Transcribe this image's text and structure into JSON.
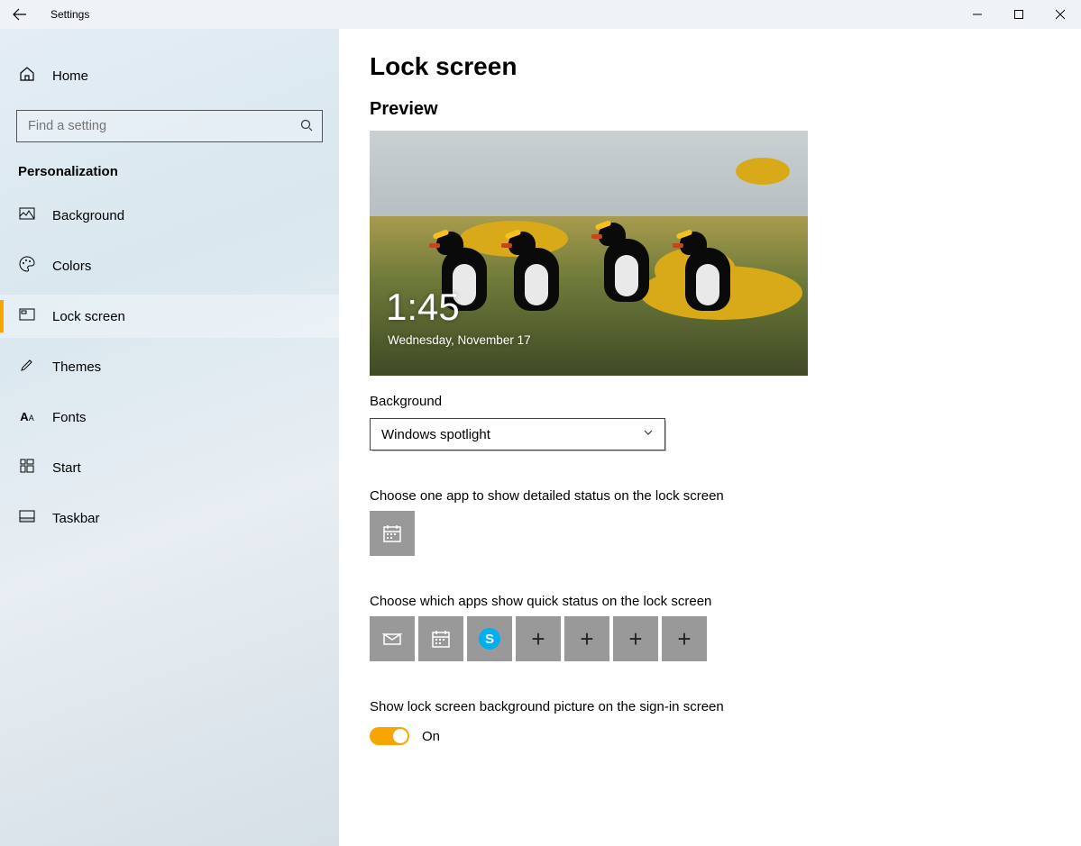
{
  "titlebar": {
    "title": "Settings"
  },
  "home": {
    "label": "Home"
  },
  "search": {
    "placeholder": "Find a setting"
  },
  "category": "Personalization",
  "nav": [
    {
      "label": "Background",
      "icon": "image"
    },
    {
      "label": "Colors",
      "icon": "palette"
    },
    {
      "label": "Lock screen",
      "icon": "lock",
      "active": true
    },
    {
      "label": "Themes",
      "icon": "brush"
    },
    {
      "label": "Fonts",
      "icon": "font"
    },
    {
      "label": "Start",
      "icon": "grid"
    },
    {
      "label": "Taskbar",
      "icon": "taskbar"
    }
  ],
  "page": {
    "title": "Lock screen",
    "preview_heading": "Preview",
    "preview_time": "1:45",
    "preview_date": "Wednesday, November 17",
    "background_label": "Background",
    "background_value": "Windows spotlight",
    "detailed_label": "Choose one app to show detailed status on the lock screen",
    "detailed_slots": [
      {
        "app": "calendar"
      }
    ],
    "quick_label": "Choose which apps show quick status on the lock screen",
    "quick_slots": [
      {
        "app": "mail"
      },
      {
        "app": "calendar"
      },
      {
        "app": "skype"
      },
      {
        "app": null
      },
      {
        "app": null
      },
      {
        "app": null
      },
      {
        "app": null
      }
    ],
    "signin_bg_label": "Show lock screen background picture on the sign-in screen",
    "signin_bg_state": "On"
  }
}
